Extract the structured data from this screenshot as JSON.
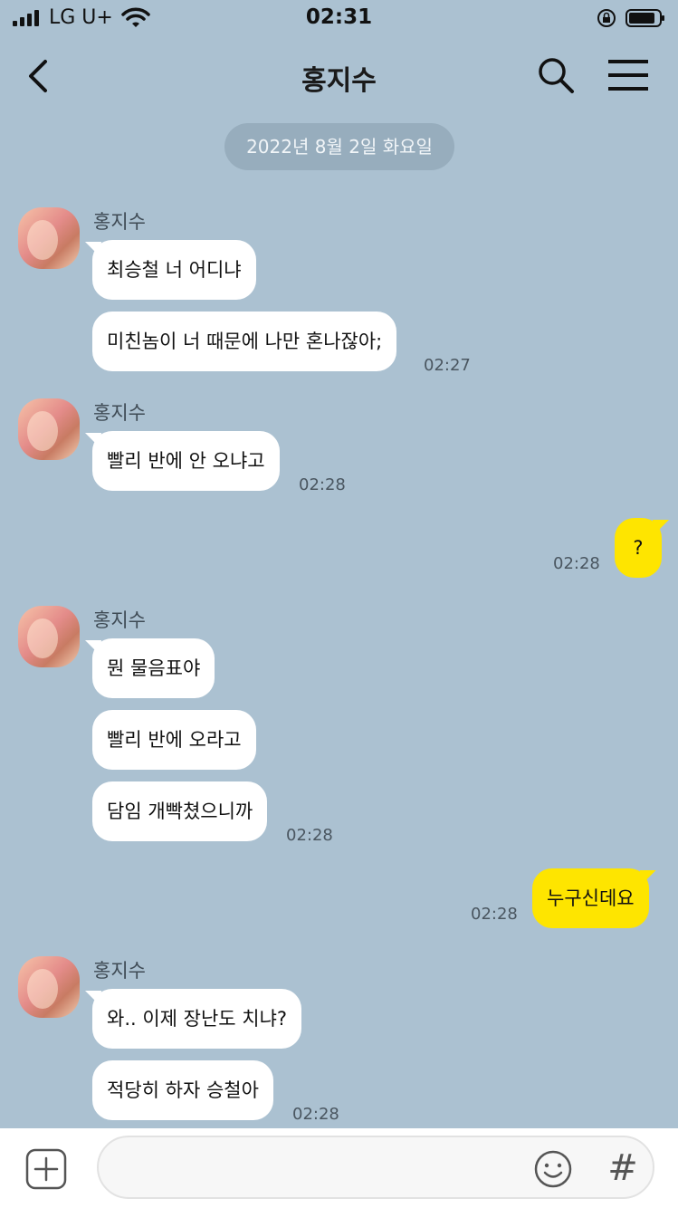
{
  "status_bar": {
    "carrier": "LG U+",
    "time": "02:31"
  },
  "header": {
    "title": "홍지수",
    "back_icon": "chevron-left",
    "search_icon": "magnifier",
    "menu_icon": "hamburger"
  },
  "date_divider": "2022년 8월 2일 화요일",
  "messages": [
    {
      "sender": "홍지수",
      "bubbles": [
        "최승철 너 어디냐",
        "미친놈이 너 때문에 나만 혼나잖아;"
      ],
      "time": "02:27"
    },
    {
      "sender": "홍지수",
      "bubbles": [
        "빨리 반에 안 오냐고"
      ],
      "time": "02:28"
    },
    {
      "mine": true,
      "bubbles": [
        "?"
      ],
      "time": "02:28"
    },
    {
      "sender": "홍지수",
      "bubbles": [
        "뭔 물음표야",
        "빨리 반에 오라고",
        "담임 개빡쳤으니까"
      ],
      "time": "02:28"
    },
    {
      "mine": true,
      "bubbles": [
        "누구신데요"
      ],
      "time": "02:28"
    },
    {
      "sender": "홍지수",
      "bubbles": [
        "와.. 이제 장난도 치냐?",
        "적당히 하자 승철아"
      ],
      "time": "02:28"
    }
  ],
  "composer": {
    "value": "",
    "plus_icon": "plus-square",
    "emoji_icon": "smiley",
    "hash_symbol": "#"
  },
  "colors": {
    "background": "#abc1d1",
    "my_bubble": "#fee500",
    "their_bubble": "#ffffff"
  }
}
